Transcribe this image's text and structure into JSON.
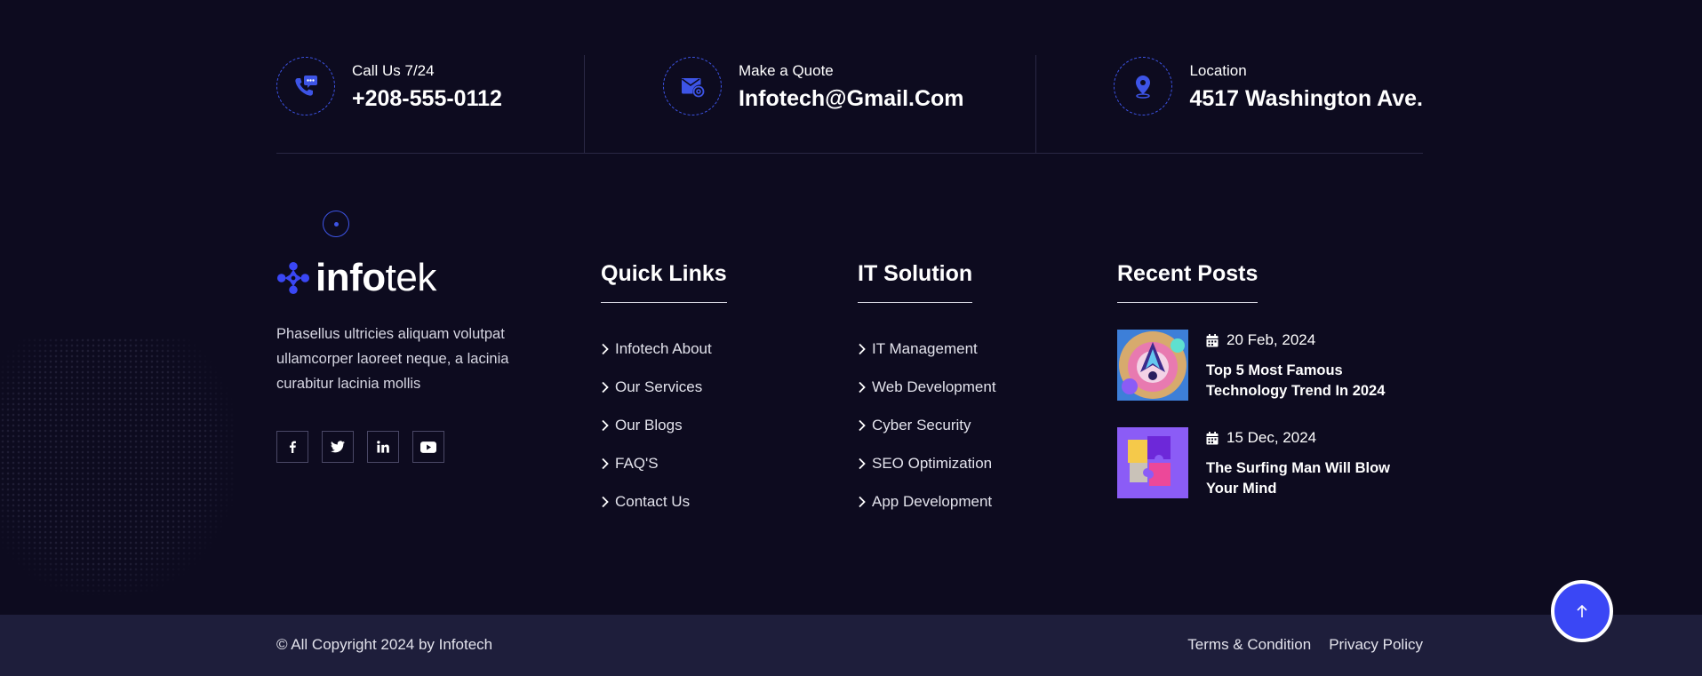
{
  "contact": [
    {
      "icon": "phone-chat-icon",
      "label": "Call Us 7/24",
      "value": "+208-555-0112"
    },
    {
      "icon": "mail-at-icon",
      "label": "Make a Quote",
      "value": "Infotech@Gmail.Com"
    },
    {
      "icon": "location-pin-icon",
      "label": "Location",
      "value": "4517 Washington Ave."
    }
  ],
  "brand": {
    "logo_bold": "info",
    "logo_light": "tek",
    "about": "Phasellus ultricies aliquam volutpat ullamcorper laoreet neque, a lacinia curabitur lacinia mollis",
    "socials": [
      "facebook-icon",
      "twitter-icon",
      "linkedin-icon",
      "youtube-icon"
    ]
  },
  "quick_links": {
    "title": "Quick Links",
    "items": [
      "Infotech About",
      "Our Services",
      "Our Blogs",
      "FAQ'S",
      "Contact Us"
    ]
  },
  "it_solution": {
    "title": "IT Solution",
    "items": [
      "IT Management",
      "Web Development",
      "Cyber Security",
      "SEO Optimization",
      "App Development"
    ]
  },
  "recent_posts": {
    "title": "Recent Posts",
    "posts": [
      {
        "date": "20 Feb, 2024",
        "title": "Top 5 Most Famous Technology Trend In 2024"
      },
      {
        "date": "15 Dec, 2024",
        "title": "The Surfing Man Will Blow Your Mind"
      }
    ]
  },
  "footer": {
    "copyright": "© All Copyright 2024 by Infotech",
    "terms": "Terms & Condition",
    "privacy": "Privacy Policy"
  },
  "colors": {
    "background": "#0d0b1f",
    "accent": "#3a47f5",
    "bottom_bar": "#1e1e3b"
  }
}
